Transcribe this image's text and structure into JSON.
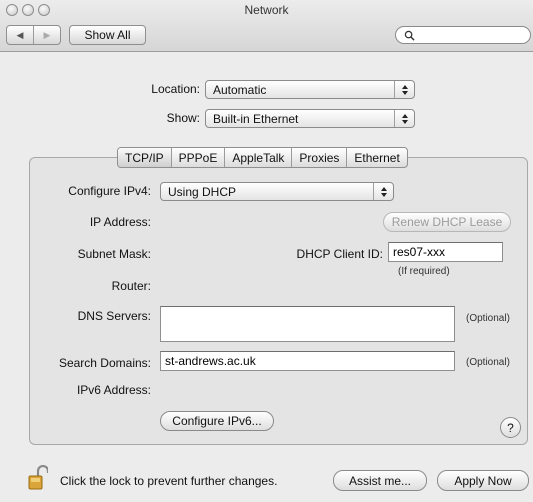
{
  "window": {
    "title": "Network"
  },
  "toolbar": {
    "back_label": "◀",
    "forward_label": "▶",
    "show_all_label": "Show All",
    "search_value": "",
    "search_placeholder": ""
  },
  "location": {
    "label": "Location:",
    "value": "Automatic"
  },
  "show": {
    "label": "Show:",
    "value": "Built-in Ethernet"
  },
  "tabs": [
    {
      "label": "TCP/IP",
      "active": true
    },
    {
      "label": "PPPoE"
    },
    {
      "label": "AppleTalk"
    },
    {
      "label": "Proxies"
    },
    {
      "label": "Ethernet"
    }
  ],
  "tcpip": {
    "configure_label": "Configure IPv4:",
    "configure_value": "Using DHCP",
    "ip_label": "IP Address:",
    "renew_label": "Renew DHCP Lease",
    "subnet_label": "Subnet Mask:",
    "client_id_label": "DHCP Client ID:",
    "client_id_value": "res07-xxx",
    "if_required": "(If required)",
    "router_label": "Router:",
    "dns_label": "DNS Servers:",
    "dns_value": "",
    "dns_optional": "(Optional)",
    "search_domains_label": "Search Domains:",
    "search_domains_value": "st-andrews.ac.uk",
    "search_optional": "(Optional)",
    "ipv6_label": "IPv6 Address:",
    "configure_ipv6_label": "Configure IPv6...",
    "help_label": "?"
  },
  "footer": {
    "lock_text": "Click the lock to prevent further changes.",
    "assist_label": "Assist me...",
    "apply_label": "Apply Now"
  }
}
